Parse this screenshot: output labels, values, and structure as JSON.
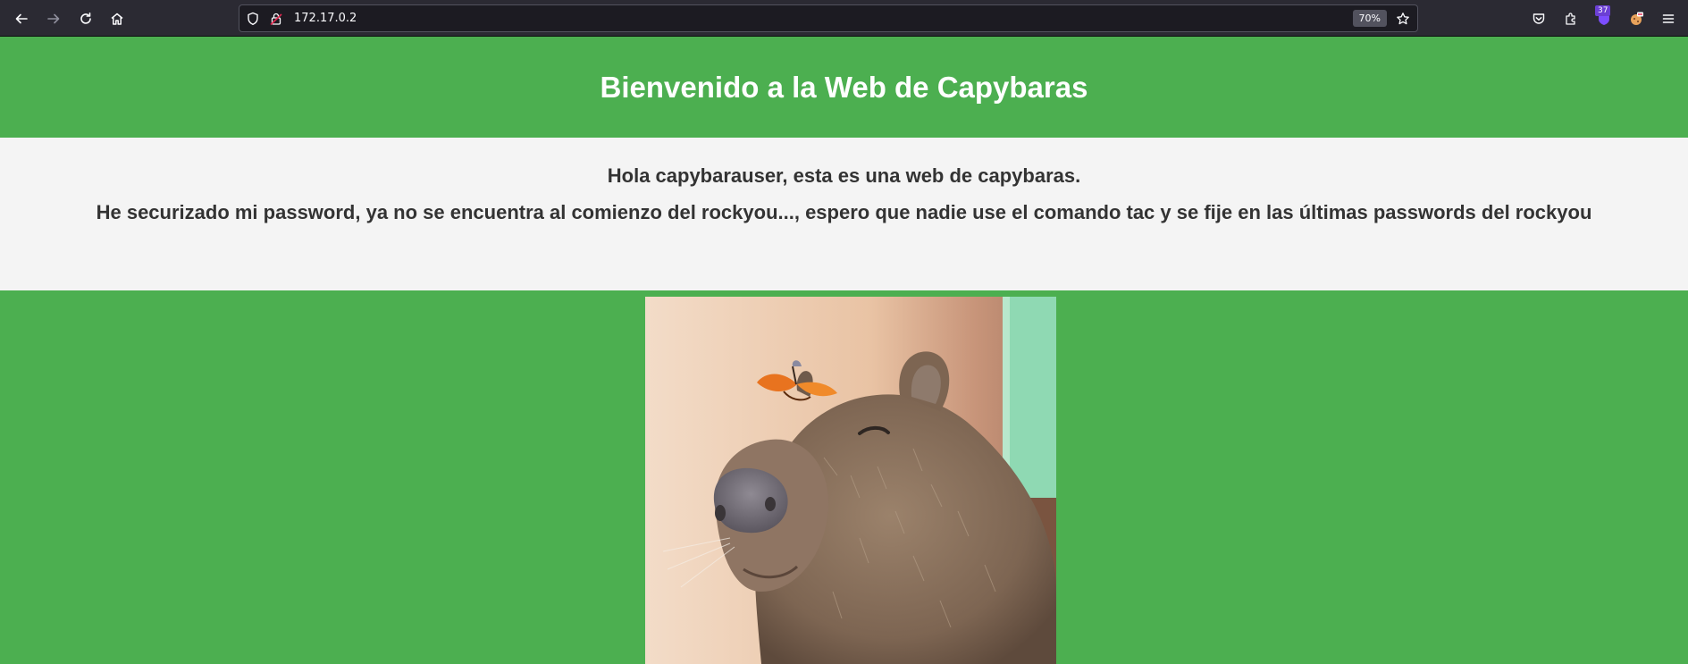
{
  "browser": {
    "url": "172.17.0.2",
    "zoom": "70%",
    "extension_badge_count": "37",
    "icons": {
      "back": "arrow-left-icon",
      "forward": "arrow-right-icon",
      "reload": "reload-icon",
      "home": "home-icon",
      "shield": "shield-icon",
      "insecure_lock": "insecure-lock-icon",
      "bookmark": "star-icon",
      "pocket": "pocket-icon",
      "extensions": "puzzle-icon",
      "menu": "hamburger-menu-icon"
    },
    "colors": {
      "toolbar": "#2b2a33",
      "urlbar": "#1c1b22"
    }
  },
  "page": {
    "title": "Bienvenido a la Web de Capybaras",
    "greeting": "Hola capybarauser, esta es una web de capybaras.",
    "hint": "He securizado mi password, ya no se encuentra al comienzo del rockyou..., espero que nadie use el comando tac y se fije en las últimas passwords del rockyou",
    "colors": {
      "header_bg": "#4caf50",
      "content_bg": "#f4f4f4",
      "text": "#333333"
    },
    "image": {
      "subject": "capybara-with-butterfly-photo"
    }
  }
}
